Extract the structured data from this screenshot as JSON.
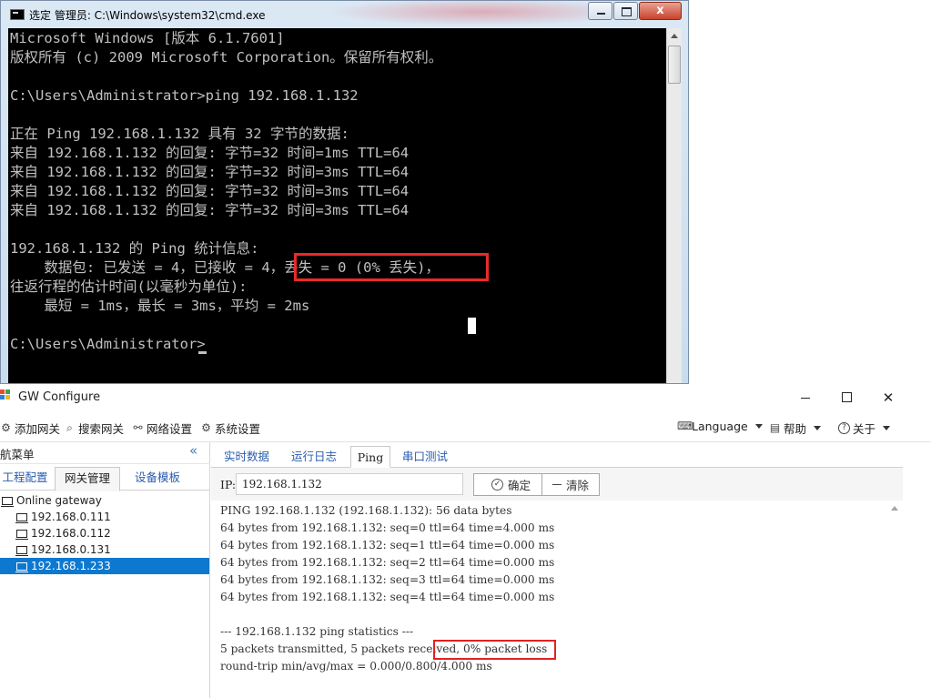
{
  "cmd": {
    "title": "选定 管理员: C:\\Windows\\system32\\cmd.exe",
    "close_glyph": "x",
    "lines": [
      "Microsoft Windows [版本 6.1.7601]",
      "版权所有 (c) 2009 Microsoft Corporation。保留所有权利。",
      "",
      "C:\\Users\\Administrator>ping 192.168.1.132",
      "",
      "正在 Ping 192.168.1.132 具有 32 字节的数据:",
      "来自 192.168.1.132 的回复: 字节=32 时间=1ms TTL=64",
      "来自 192.168.1.132 的回复: 字节=32 时间=3ms TTL=64",
      "来自 192.168.1.132 的回复: 字节=32 时间=3ms TTL=64",
      "来自 192.168.1.132 的回复: 字节=32 时间=3ms TTL=64",
      "",
      "192.168.1.132 的 Ping 统计信息:",
      "    数据包: 已发送 = 4，已接收 = 4，丢失 = 0 (0% 丢失)，",
      "往返行程的估计时间(以毫秒为单位):",
      "    最短 = 1ms，最长 = 3ms，平均 = 2ms",
      "",
      "C:\\Users\\Administrator>"
    ],
    "colors": {
      "background": "#000000",
      "text": "#c0c0c0",
      "highlight": "#e82a2a"
    }
  },
  "gw": {
    "title": "GW Configure",
    "close_glyph": "✕",
    "toolbar": {
      "add_gateway": "添加网关",
      "search_gateway": "搜索网关",
      "network_settings": "网络设置",
      "system_settings": "系统设置",
      "language": "Language",
      "help": "帮助",
      "about": "关于"
    },
    "nav": {
      "header": "航菜单",
      "collapse_glyph": "«",
      "tabs": [
        "工程配置",
        "网关管理",
        "设备模板"
      ],
      "active_tab": "网关管理",
      "tree_root": "Online gateway",
      "gateways": [
        "192.168.0.111",
        "192.168.0.112",
        "192.168.0.131",
        "192.168.1.233"
      ],
      "selected_gateway": "192.168.1.233"
    },
    "tabs": [
      "实时数据",
      "运行日志",
      "Ping",
      "串口测试"
    ],
    "active_tab": "Ping",
    "ping": {
      "ip_label": "IP:",
      "ip_value": "192.168.1.132",
      "ok_label": "确定",
      "clear_label": "清除",
      "output": [
        "PING 192.168.1.132 (192.168.1.132): 56 data bytes",
        "64 bytes from 192.168.1.132: seq=0 ttl=64 time=4.000 ms",
        "64 bytes from 192.168.1.132: seq=1 ttl=64 time=0.000 ms",
        "64 bytes from 192.168.1.132: seq=2 ttl=64 time=0.000 ms",
        "64 bytes from 192.168.1.132: seq=3 ttl=64 time=0.000 ms",
        "64 bytes from 192.168.1.132: seq=4 ttl=64 time=0.000 ms",
        "",
        "--- 192.168.1.132 ping statistics ---",
        "5 packets transmitted, 5 packets received, 0% packet loss",
        "round-trip min/avg/max = 0.000/0.800/4.000 ms"
      ]
    },
    "colors": {
      "accent": "#0d78d0",
      "link": "#2a5db0",
      "highlight": "#e02222"
    }
  }
}
